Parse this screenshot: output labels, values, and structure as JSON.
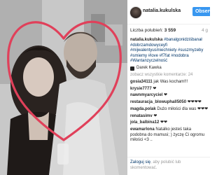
{
  "post": {
    "photo_description_icon": "photo-with-heart-drawing",
    "heart_color": "#e0405a"
  },
  "header": {
    "username": "natalia.kukulska",
    "follow_label": "Obserw"
  },
  "stats": {
    "likes_label": "Liczba polubień:",
    "likes_count": "3 559",
    "age": "4 g"
  },
  "caption": {
    "user": "natalia.kukulska",
    "text": "#banalgonidziśbanał #dobrzamdowyceyfi #mijwalentyusmiechniety #suszmyzeby #smiemy #love #f7fat #nodobra #Wantanzyczelność",
    "tagged": "Darek Kawka"
  },
  "more_comments": "zobacz wszystkie komentarze: 24",
  "comments": [
    {
      "user": "gosia34111",
      "text": "jak Was kocham!!!"
    },
    {
      "user": "krysie7777",
      "text": "❤"
    },
    {
      "user": "nawnmyarcyciel",
      "text": "❤"
    },
    {
      "user": "restauracja_blowuphall5050",
      "text": "❤❤❤❤"
    },
    {
      "user": "magda.polak",
      "text": "Dużo miłości dla was ❤❤❤"
    },
    {
      "user": "renatasimv",
      "text": "❤"
    },
    {
      "user": "jola_balbina12",
      "text": "❤❤"
    },
    {
      "user": "ewamarlona",
      "text": "Natalko jesteś taka podobna do mamusi; ) życzę Ci ogromu miłości <3 .."
    }
  ],
  "login": {
    "link": "Zaloguj się",
    "text": ", aby polubić lub skomentować."
  }
}
